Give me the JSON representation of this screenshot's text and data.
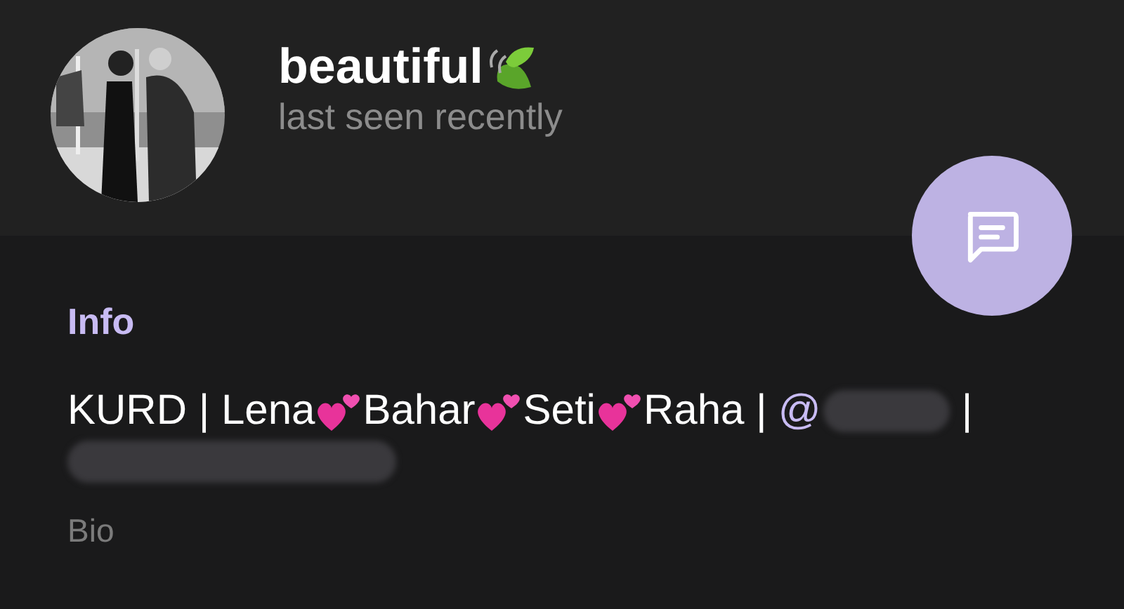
{
  "profile": {
    "name": "beautiful",
    "status": "last seen recently"
  },
  "info": {
    "heading": "Info",
    "bio_lines": [
      [
        {
          "kind": "text",
          "text": "KURD | Lena"
        },
        {
          "kind": "hearts-icon"
        },
        {
          "kind": "text",
          "text": "Bahar"
        },
        {
          "kind": "hearts-icon"
        },
        {
          "kind": "text",
          "text": "Seti"
        },
        {
          "kind": "hearts-icon"
        },
        {
          "kind": "text",
          "text": "Raha |"
        },
        {
          "kind": "link",
          "text": "@"
        },
        {
          "kind": "redaction"
        },
        {
          "kind": "text",
          "text": "|"
        }
      ],
      [
        {
          "kind": "redaction",
          "wide": true
        }
      ]
    ],
    "caption": "Bio"
  }
}
